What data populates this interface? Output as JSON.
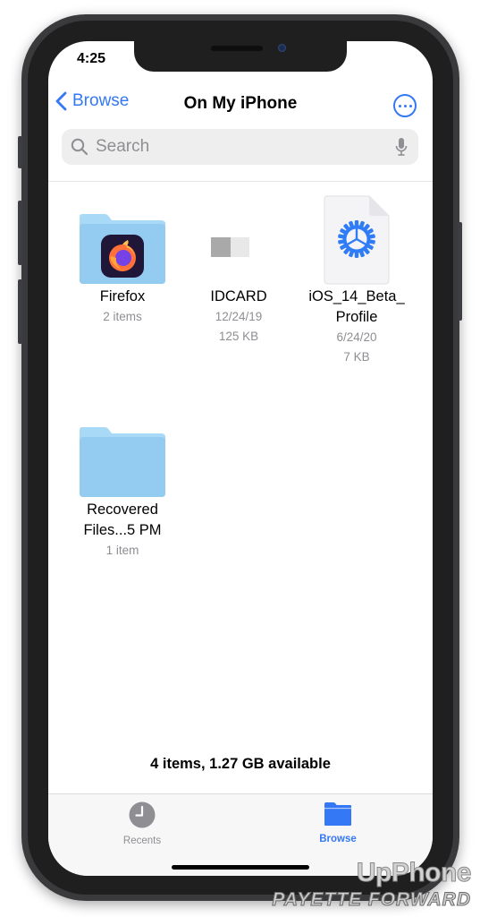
{
  "status_bar": {
    "time": "4:25"
  },
  "nav": {
    "back_label": "Browse",
    "title": "On My iPhone",
    "more_icon": "ellipsis-circle-icon"
  },
  "search": {
    "placeholder": "Search",
    "value": ""
  },
  "items": [
    {
      "name": "Firefox",
      "meta": [
        "2 items"
      ],
      "type": "folder",
      "badge": "firefox-app-icon"
    },
    {
      "name": "IDCARD",
      "meta": [
        "12/24/19",
        "125 KB"
      ],
      "type": "file-thumbnail"
    },
    {
      "name": "iOS_14_Beta_ Profile",
      "name_lines": [
        "iOS_14_Beta_",
        "Profile"
      ],
      "meta": [
        "6/24/20",
        "7 KB"
      ],
      "type": "settings-profile-file"
    },
    {
      "name": "Recovered Files...5 PM",
      "name_lines": [
        "Recovered",
        "Files...5 PM"
      ],
      "meta": [
        "1 item"
      ],
      "type": "folder"
    }
  ],
  "footer": {
    "summary": "4 items, 1.27 GB available"
  },
  "tabbar": {
    "tabs": [
      {
        "label": "Recents",
        "icon": "clock-icon",
        "active": false
      },
      {
        "label": "Browse",
        "icon": "folder-icon",
        "active": true
      }
    ]
  },
  "colors": {
    "accent": "#3478f6",
    "folder": "#9fd0f4",
    "inactive": "#8e8e93"
  },
  "watermark": {
    "line1": "UpPhone",
    "line2": "PAYETTE FORWARD"
  }
}
